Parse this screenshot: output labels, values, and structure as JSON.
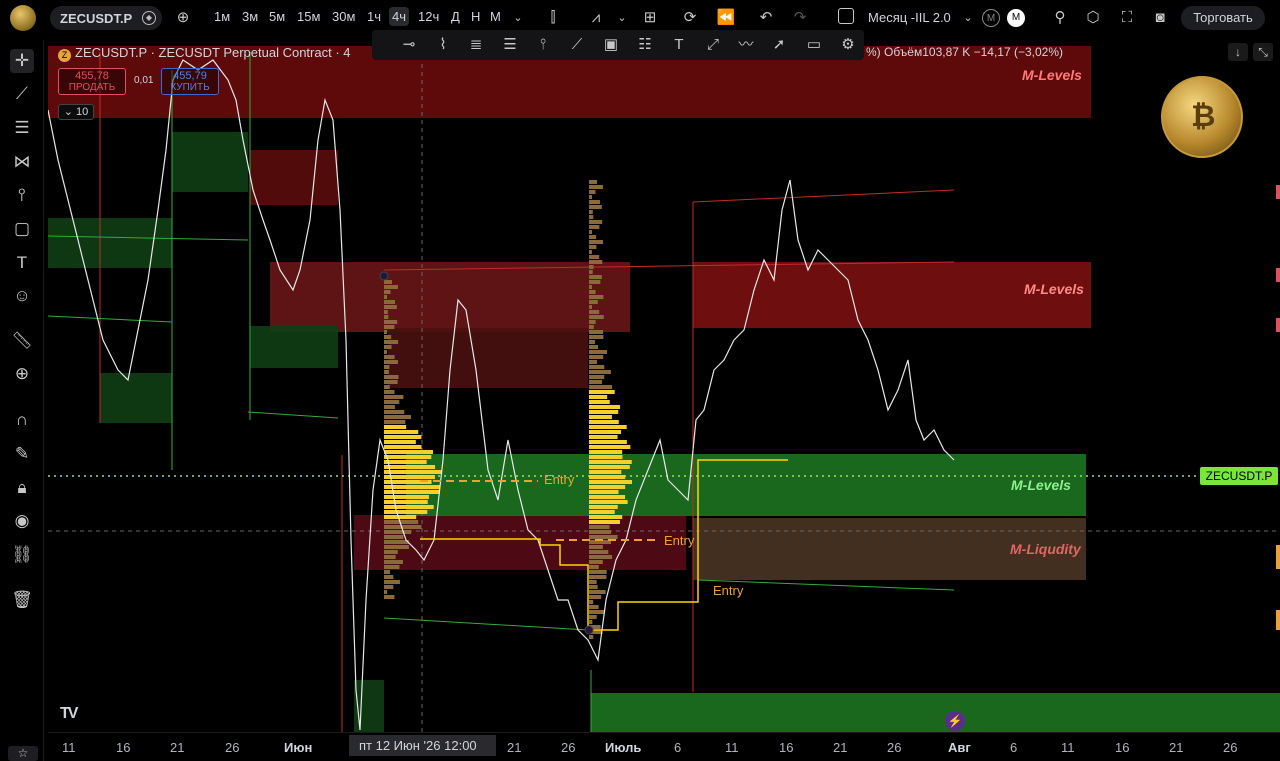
{
  "toolbar": {
    "symbol": "ZECUSDT.P",
    "intervals": [
      "1м",
      "3м",
      "5м",
      "15м",
      "30м",
      "1ч",
      "4ч",
      "12ч",
      "Д",
      "Н",
      "М"
    ],
    "active_interval": "4ч",
    "indicator_name": "Месяц -IIL 2.0",
    "m_label": "M",
    "trade_label": "Торговать"
  },
  "legend": {
    "title": "ZECUSDT.P · ZECUSDT Perpetual Contract · 4",
    "stats": "%) Объём103,87 K  −14,17 (−3,02%)"
  },
  "order": {
    "sell_price": "455,78",
    "sell_label": "ПРОДАТЬ",
    "spread": "0,01",
    "buy_price": "455,79",
    "buy_label": "КУПИТЬ",
    "quantity": "10"
  },
  "zones": {
    "m_levels": "M-Levels",
    "m_liquidity": "M-Liqudity",
    "entry": "Entry"
  },
  "price_tag": "ZECUSDT.P",
  "time_axis": {
    "ticks": [
      "11",
      "16",
      "21",
      "26",
      "Июн",
      "21",
      "26",
      "Июль",
      "6",
      "11",
      "16",
      "21",
      "26",
      "Авг",
      "6",
      "11",
      "16",
      "21",
      "26"
    ],
    "crosshair": "пт 12 Июн '26   12:00"
  },
  "colors": {
    "resistance": "#b31b1b",
    "support": "#2fae3a",
    "liquidity": "#6b4a2a",
    "entry": "#f0a030",
    "poc": "#ffd400",
    "price_tag": "#7ae63a"
  },
  "icons": {
    "left_tools": [
      "crosshair-icon",
      "trend-line-icon",
      "fib-icon",
      "pattern-icon",
      "forecast-icon",
      "shape-icon",
      "text-icon",
      "emoji-icon",
      "ruler-icon",
      "zoom-icon",
      "magnet-icon",
      "pencil-lock-icon",
      "lock-icon",
      "eye-icon",
      "link-icon",
      "trash-icon"
    ]
  }
}
